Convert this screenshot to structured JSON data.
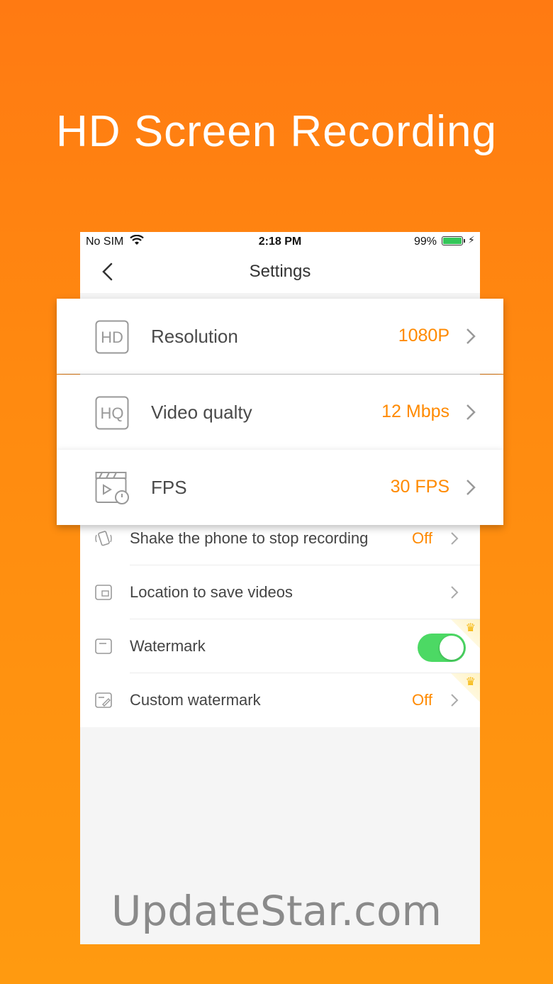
{
  "headline": "HD Screen Recording",
  "status_bar": {
    "carrier": "No SIM",
    "time": "2:18 PM",
    "battery_percent": "99%"
  },
  "nav": {
    "title": "Settings",
    "back_icon": "chevron-left-icon"
  },
  "cards": [
    {
      "icon": "hd-icon",
      "icon_text": "HD",
      "label": "Resolution",
      "value": "1080P"
    },
    {
      "icon": "hq-icon",
      "icon_text": "HQ",
      "label": "Video qualty",
      "value": "12 Mbps"
    },
    {
      "icon": "clapper-timer-icon",
      "label": "FPS",
      "value": "30 FPS"
    }
  ],
  "rows": [
    {
      "icon": "shake-phone-icon",
      "label": "Shake the phone to stop recording",
      "value": "Off"
    },
    {
      "icon": "folder-icon",
      "label": "Location to save videos",
      "value": ""
    },
    {
      "icon": "watermark-icon",
      "label": "Watermark",
      "toggle_on": true,
      "premium": true
    },
    {
      "icon": "edit-watermark-icon",
      "label": "Custom watermark",
      "value": "Off",
      "premium": true
    }
  ],
  "colors": {
    "accent": "#ff8a00",
    "background_top": "#ff7a12",
    "toggle_on": "#4cd964"
  },
  "site_watermark": "UpdateStar.com"
}
